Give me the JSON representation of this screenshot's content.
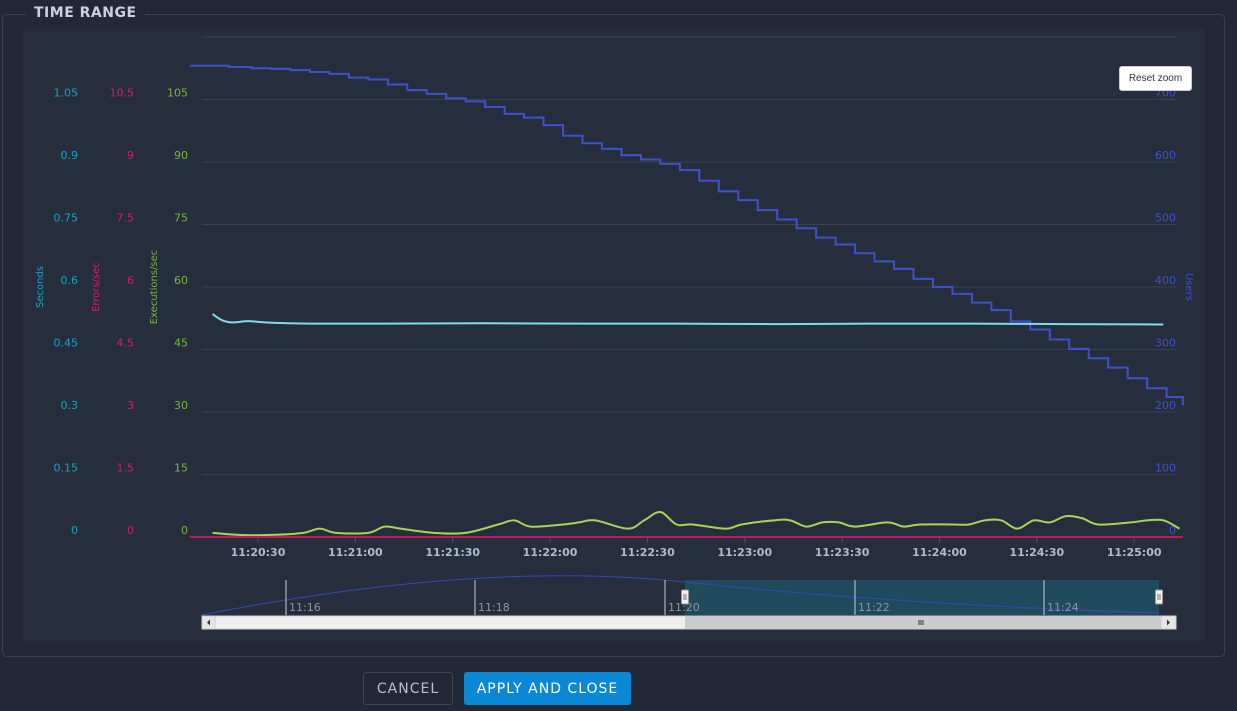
{
  "panel": {
    "title": "TIME RANGE"
  },
  "buttons": {
    "cancel": "CANCEL",
    "apply": "APPLY AND CLOSE",
    "reset_zoom": "Reset zoom"
  },
  "colors": {
    "seconds": "#15a2c4",
    "errors": "#d11f5f",
    "executions": "#7cb342",
    "users": "#3f51c8",
    "seconds_line": "#7fdceb",
    "executions_line": "#a6d45a",
    "errors_line": "#c2185b",
    "grid": "#3a4448",
    "axis_text": "#b0bac8",
    "navigator_selection": "#1f4b5c"
  },
  "chart_data": {
    "type": "line",
    "title": "",
    "xlabel": "",
    "x_ticks": [
      "11:20:30",
      "11:21:00",
      "11:21:30",
      "11:22:00",
      "11:22:30",
      "11:23:00",
      "11:23:30",
      "11:24:00",
      "11:24:30",
      "11:25:00"
    ],
    "x_range": [
      "11:20:09",
      "11:25:15"
    ],
    "y_axes": [
      {
        "name": "Seconds",
        "label": "Seconds",
        "range": [
          0,
          1.2
        ],
        "ticks": [
          "0",
          "0.15",
          "0.3",
          "0.45",
          "0.6",
          "0.75",
          "0.9",
          "1.05"
        ],
        "color": "#15a2c4",
        "side": "left"
      },
      {
        "name": "Errors/sec",
        "label": "Errors/sec",
        "range": [
          0,
          12
        ],
        "ticks": [
          "0",
          "1.5",
          "3",
          "4.5",
          "6",
          "7.5",
          "9",
          "10.5"
        ],
        "color": "#d11f5f",
        "side": "left"
      },
      {
        "name": "Executions/sec",
        "label": "Executions/sec",
        "range": [
          0,
          120
        ],
        "ticks": [
          "0",
          "15",
          "30",
          "45",
          "60",
          "75",
          "90",
          "105"
        ],
        "color": "#7cb342",
        "side": "left"
      },
      {
        "name": "Users",
        "label": "Users",
        "range": [
          0,
          800
        ],
        "ticks": [
          "0",
          "100",
          "200",
          "300",
          "400",
          "500",
          "600",
          "700"
        ],
        "color": "#3f51c8",
        "side": "right"
      }
    ],
    "grid": true,
    "series": [
      {
        "name": "Users",
        "axis": "Users",
        "step": true,
        "color": "#3f51c8",
        "x_seconds": [
          0,
          12,
          19,
          25,
          31,
          37,
          43,
          49,
          55,
          61,
          67,
          73,
          79,
          85,
          91,
          97,
          103,
          109,
          115,
          121,
          127,
          133,
          139,
          145,
          151,
          157,
          163,
          169,
          175,
          181,
          187,
          193,
          199,
          205,
          211,
          217,
          223,
          229,
          235,
          241,
          247,
          253,
          259,
          265,
          271,
          277,
          283,
          289,
          295,
          301,
          306
        ],
        "values": [
          754,
          752,
          750,
          749,
          747,
          744,
          741,
          735,
          732,
          724,
          715,
          709,
          702,
          697,
          688,
          677,
          671,
          659,
          642,
          630,
          621,
          611,
          604,
          597,
          587,
          570,
          553,
          539,
          523,
          508,
          494,
          479,
          468,
          454,
          441,
          429,
          413,
          400,
          389,
          375,
          363,
          345,
          332,
          316,
          301,
          286,
          271,
          254,
          238,
          224,
          211
        ]
      },
      {
        "name": "Seconds",
        "axis": "Seconds",
        "color": "#7fdceb",
        "x_seconds": [
          7,
          10,
          13,
          18,
          23,
          30,
          40,
          60,
          90,
          120,
          150,
          180,
          210,
          240,
          270,
          300
        ],
        "values": [
          0.535,
          0.52,
          0.515,
          0.518,
          0.515,
          0.513,
          0.512,
          0.512,
          0.513,
          0.512,
          0.512,
          0.511,
          0.512,
          0.512,
          0.511,
          0.51
        ]
      },
      {
        "name": "Executions/sec",
        "axis": "Executions/sec",
        "color": "#a6d45a",
        "x_seconds": [
          7,
          15,
          25,
          35,
          40,
          45,
          55,
          60,
          65,
          75,
          85,
          95,
          100,
          105,
          115,
          120,
          125,
          135,
          140,
          145,
          150,
          155,
          165,
          170,
          180,
          185,
          190,
          195,
          200,
          205,
          215,
          220,
          225,
          235,
          240,
          245,
          250,
          255,
          260,
          265,
          270,
          275,
          280,
          290,
          295,
          300,
          305
        ],
        "values": [
          1,
          0.5,
          0.5,
          1,
          2,
          1,
          1,
          2.5,
          2,
          1,
          1,
          3,
          4,
          2.5,
          3,
          3.5,
          4,
          2,
          4,
          6,
          3,
          3,
          2,
          3,
          4,
          4,
          2.5,
          3.5,
          3.5,
          2.5,
          3.5,
          2.5,
          3,
          3,
          3,
          4,
          4,
          2,
          4,
          3.5,
          5,
          4.5,
          3,
          3.5,
          4,
          4,
          2
        ]
      },
      {
        "name": "Errors/sec",
        "axis": "Errors/sec",
        "color": "#c2185b",
        "x_seconds": [
          0,
          306
        ],
        "values": [
          0,
          0
        ]
      }
    ],
    "navigator": {
      "ticks": [
        "11:16",
        "11:18",
        "11:20",
        "11:22",
        "11:24"
      ],
      "selection": [
        "11:20:09",
        "11:25:15"
      ]
    }
  }
}
